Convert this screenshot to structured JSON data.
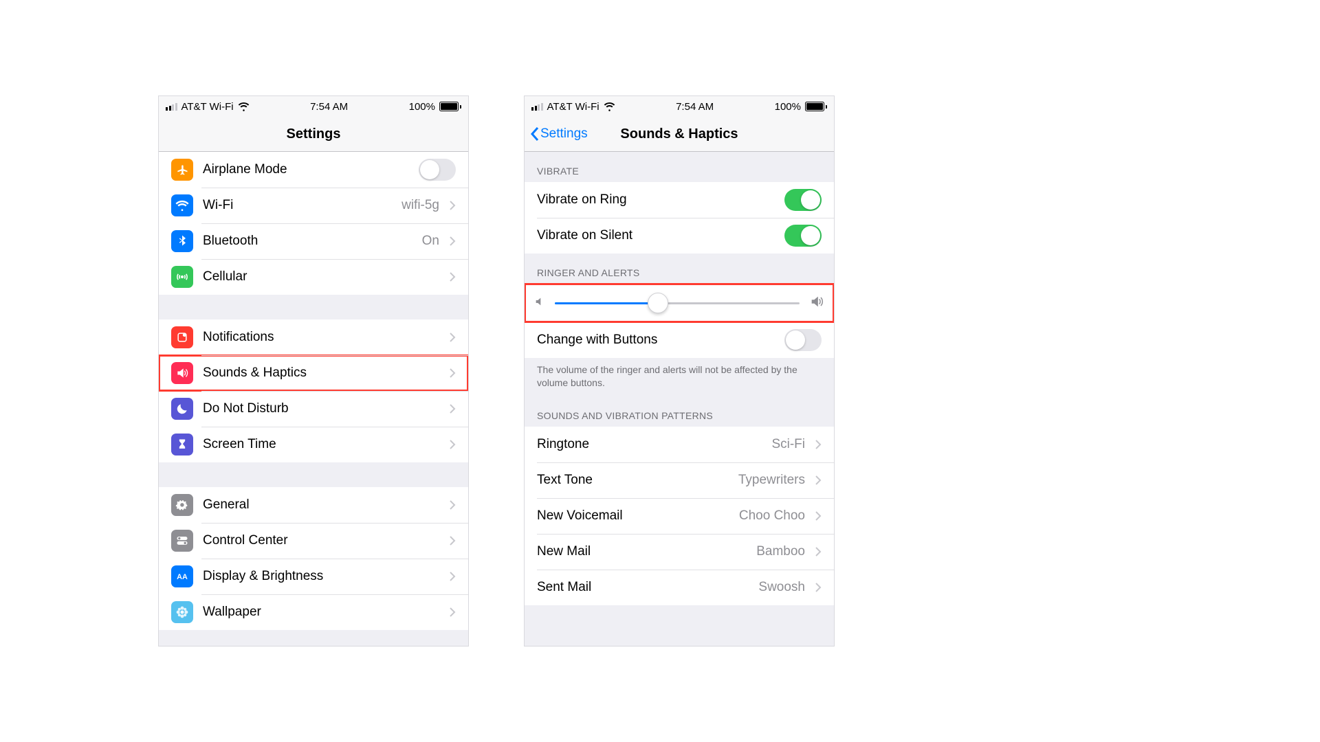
{
  "status": {
    "carrier": "AT&T Wi-Fi",
    "time": "7:54 AM",
    "battery_pct": "100%",
    "battery_fill": 100,
    "signal_active_bars": 2
  },
  "left": {
    "nav_title": "Settings",
    "groups": [
      {
        "rows": [
          {
            "id": "airplane",
            "icon": "airplane",
            "bg": "#ff9500",
            "label": "Airplane Mode",
            "type": "switch",
            "on": false
          },
          {
            "id": "wifi",
            "icon": "wifi",
            "bg": "#007aff",
            "label": "Wi-Fi",
            "type": "disclosure",
            "value": "wifi-5g"
          },
          {
            "id": "bluetooth",
            "icon": "bluetooth",
            "bg": "#007aff",
            "label": "Bluetooth",
            "type": "disclosure",
            "value": "On"
          },
          {
            "id": "cellular",
            "icon": "antenna",
            "bg": "#34c759",
            "label": "Cellular",
            "type": "disclosure"
          }
        ]
      },
      {
        "rows": [
          {
            "id": "notifications",
            "icon": "bell",
            "bg": "#ff3b30",
            "label": "Notifications",
            "type": "disclosure"
          },
          {
            "id": "sounds",
            "icon": "speaker",
            "bg": "#ff2d55",
            "label": "Sounds & Haptics",
            "type": "disclosure",
            "highlight": true
          },
          {
            "id": "dnd",
            "icon": "moon",
            "bg": "#5856d6",
            "label": "Do Not Disturb",
            "type": "disclosure"
          },
          {
            "id": "screentime",
            "icon": "hourglass",
            "bg": "#5856d6",
            "label": "Screen Time",
            "type": "disclosure"
          }
        ]
      },
      {
        "rows": [
          {
            "id": "general",
            "icon": "gear",
            "bg": "#8e8e93",
            "label": "General",
            "type": "disclosure"
          },
          {
            "id": "controlcenter",
            "icon": "switches",
            "bg": "#8e8e93",
            "label": "Control Center",
            "type": "disclosure"
          },
          {
            "id": "display",
            "icon": "AA",
            "bg": "#007aff",
            "label": "Display & Brightness",
            "type": "disclosure"
          },
          {
            "id": "wallpaper",
            "icon": "flower",
            "bg": "#56c1ef",
            "label": "Wallpaper",
            "type": "disclosure"
          }
        ]
      }
    ]
  },
  "right": {
    "nav_title": "Sounds & Haptics",
    "back_label": "Settings",
    "sections": [
      {
        "header": "Vibrate",
        "rows": [
          {
            "id": "vibring",
            "label": "Vibrate on Ring",
            "type": "switch",
            "on": true
          },
          {
            "id": "vibsilent",
            "label": "Vibrate on Silent",
            "type": "switch",
            "on": true
          }
        ]
      },
      {
        "header": "Ringer and Alerts",
        "slider": {
          "value": 42,
          "highlight": true
        },
        "rows": [
          {
            "id": "changebtn",
            "label": "Change with Buttons",
            "type": "switch",
            "on": false
          }
        ],
        "footer": "The volume of the ringer and alerts will not be affected by the volume buttons."
      },
      {
        "header": "Sounds and Vibration Patterns",
        "rows": [
          {
            "id": "ringtone",
            "label": "Ringtone",
            "type": "disclosure",
            "value": "Sci-Fi"
          },
          {
            "id": "texttone",
            "label": "Text Tone",
            "type": "disclosure",
            "value": "Typewriters"
          },
          {
            "id": "voicemail",
            "label": "New Voicemail",
            "type": "disclosure",
            "value": "Choo Choo"
          },
          {
            "id": "newmail",
            "label": "New Mail",
            "type": "disclosure",
            "value": "Bamboo"
          },
          {
            "id": "sentmail",
            "label": "Sent Mail",
            "type": "disclosure",
            "value": "Swoosh"
          }
        ]
      }
    ]
  }
}
